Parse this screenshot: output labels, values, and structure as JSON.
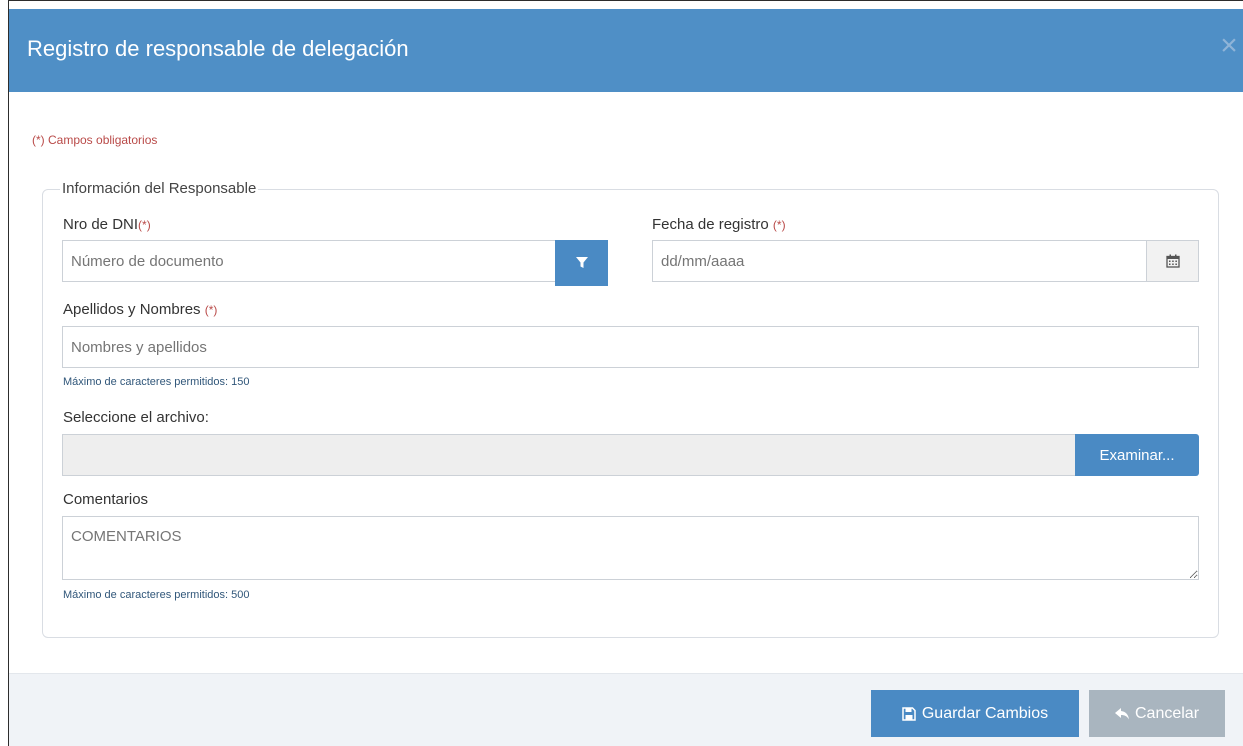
{
  "modal": {
    "title": "Registro de responsable de delegación",
    "close_symbol": "×",
    "required_note": "(*) Campos obligatorios"
  },
  "fieldset": {
    "legend": "Información del Responsable"
  },
  "dni": {
    "label": "Nro de DNI",
    "required_mark": "(*)",
    "placeholder": "Número de documento",
    "button_icon": "filter-icon"
  },
  "fecha": {
    "label": "Fecha de registro ",
    "required_mark": "(*)",
    "placeholder": "dd/mm/aaaa",
    "button_icon": "calendar-icon"
  },
  "nombres": {
    "label": "Apellidos y Nombres ",
    "required_mark": "(*)",
    "placeholder": "Nombres y apellidos",
    "help": "Máximo de caracteres permitidos: 150"
  },
  "archivo": {
    "label": "Seleccione el archivo:",
    "browse_label": "Examinar..."
  },
  "comentarios": {
    "label": "Comentarios",
    "placeholder": "COMENTARIOS",
    "help": "Máximo de caracteres permitidos: 500"
  },
  "footer": {
    "save_label": "Guardar Cambios",
    "save_icon": "floppy-disk-icon",
    "cancel_label": "Cancelar",
    "cancel_icon": "reply-arrow-icon"
  },
  "colors": {
    "header": "#4f8fc6",
    "primary": "#4a8ac4",
    "required": "#b94a48",
    "cancel": "#a9b5bf"
  }
}
